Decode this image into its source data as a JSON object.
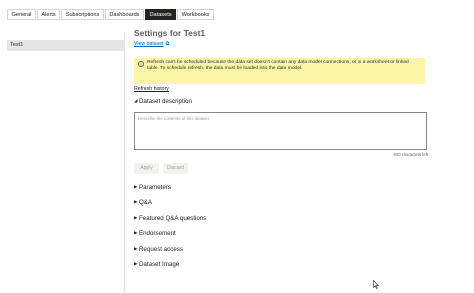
{
  "tabs": [
    {
      "label": "General",
      "active": false
    },
    {
      "label": "Alerts",
      "active": false
    },
    {
      "label": "Subscriptions",
      "active": false
    },
    {
      "label": "Dashboards",
      "active": false
    },
    {
      "label": "Datasets",
      "active": true
    },
    {
      "label": "Workbooks",
      "active": false
    }
  ],
  "sidebar": {
    "items": [
      {
        "label": "Test1",
        "selected": true
      }
    ]
  },
  "main": {
    "title": "Settings for Test1",
    "view_dataset_link": "View dataset",
    "warning_text": "Refresh can't be scheduled because the data set doesn't contain any data model connections, or is a worksheet or linked table. To schedule refresh, the data must be loaded into the data model.",
    "refresh_history_link": "Refresh history",
    "dataset_description": {
      "heading": "Dataset description",
      "placeholder": "Describe the contents of this dataset.",
      "chars_left": "500 characters left"
    },
    "buttons": {
      "apply": "Apply",
      "discard": "Discard"
    },
    "sections": [
      "Parameters",
      "Q&A",
      "Featured Q&A questions",
      "Endorsement",
      "Request access",
      "Dataset Image"
    ]
  },
  "colors": {
    "active_tab": "#252423",
    "warning_bg": "#fbf5a6",
    "link": "#0063b1",
    "selected_item_bg": "#e6e6e6"
  },
  "icons": {
    "warning": "info-circle-icon",
    "external_link": "external-link-icon",
    "caret_expanded": "caret-down-icon",
    "caret_collapsed": "caret-right-icon",
    "cursor": "mouse-pointer-icon"
  }
}
